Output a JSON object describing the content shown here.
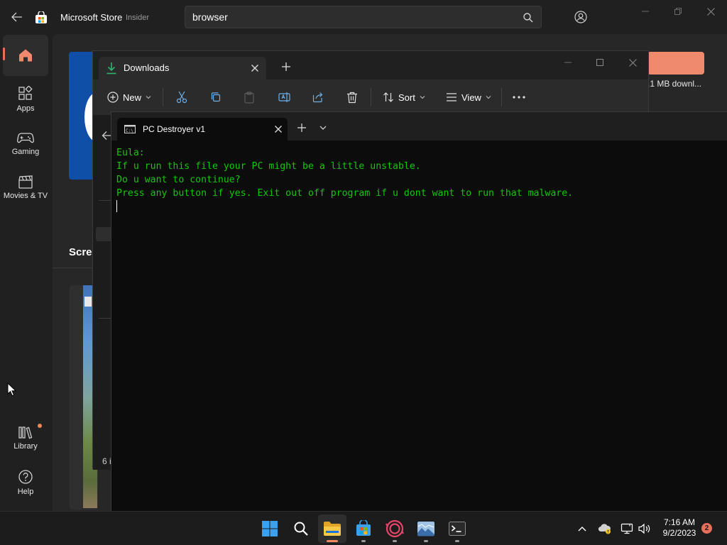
{
  "store": {
    "app_name": "Microsoft Store",
    "channel_badge": "Insider",
    "search": {
      "value": "browser",
      "placeholder": ""
    },
    "nav": [
      {
        "label": "",
        "icon": "home-icon"
      },
      {
        "label": "Apps",
        "icon": "apps-icon"
      },
      {
        "label": "Gaming",
        "icon": "gamepad-icon"
      },
      {
        "label": "Movies & TV",
        "icon": "clapperboard-icon"
      },
      {
        "label": "Library",
        "icon": "library-icon"
      },
      {
        "label": "Help",
        "icon": "help-icon"
      }
    ],
    "download_size_partial": ".1 MB downl...",
    "screenshots_heading_partial": "Scree"
  },
  "explorer": {
    "tab_title": "Downloads",
    "toolbar": {
      "new_label": "New",
      "sort_label": "Sort",
      "view_label": "View"
    },
    "status_partial": "6 i"
  },
  "terminal": {
    "tab_title": "PC Destroyer v1",
    "lines": [
      "Eula:",
      "If u run this file your PC might be a little unstable.",
      "Do u want to continue?",
      "Press any button if yes. Exit out off program if u dont want to run that malware."
    ],
    "text_color": "#16C60C"
  },
  "taskbar": {
    "time": "7:16 AM",
    "date": "9/2/2023",
    "notification_count": "2"
  },
  "colors": {
    "accent": "#F08A5D",
    "store_bg": "#202020",
    "terminal_bg": "#0C0C0C"
  }
}
